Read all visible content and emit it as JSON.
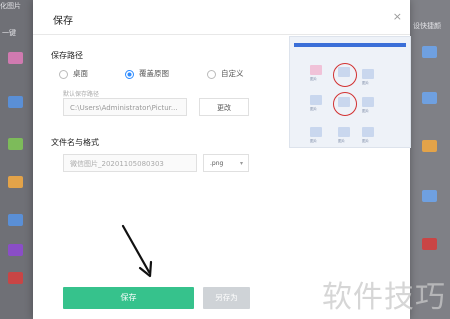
{
  "background": {
    "left_texts": [
      "化图片",
      "一键"
    ],
    "right_text": "设快捷颜"
  },
  "dialog": {
    "title": "保存",
    "close_glyph": "×",
    "save_path": {
      "heading": "保存路径",
      "options": [
        "桌面",
        "覆盖原图",
        "自定义"
      ],
      "selected": "覆盖原图",
      "default_label": "默认保存路径",
      "path_value": "C:\\Users\\Administrator\\Pictur...",
      "change_label": "更改"
    },
    "file": {
      "heading": "文件名与格式",
      "name_placeholder": "微信图片_20201105080303",
      "format": ".png"
    },
    "buttons": {
      "save": "保存",
      "save_as": "另存为"
    }
  },
  "preview": {
    "labels": [
      "图片",
      "图片",
      "图片",
      "图片",
      "图片",
      "图片",
      "图片"
    ]
  },
  "watermark": "软件技巧",
  "colors": {
    "save_button": "#36c28c",
    "save_as_button": "#cfd3d7",
    "radio_selected": "#2f8cff",
    "highlight_circle": "#d23030"
  }
}
